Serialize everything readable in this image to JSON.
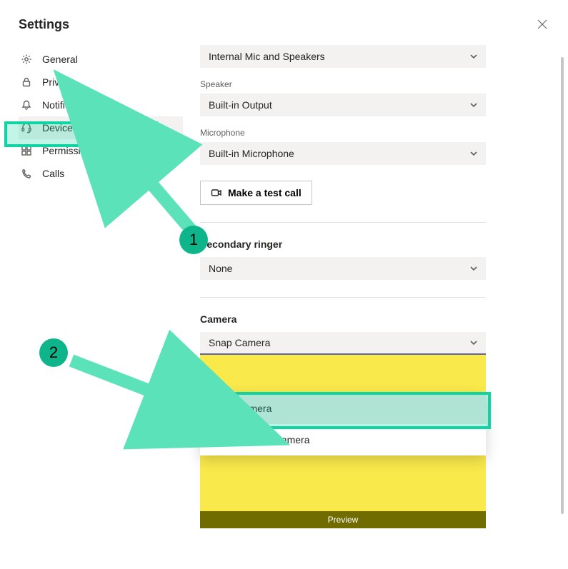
{
  "header": {
    "title": "Settings"
  },
  "sidebar": {
    "items": [
      {
        "label": "General"
      },
      {
        "label": "Privacy"
      },
      {
        "label": "Notifications"
      },
      {
        "label": "Devices"
      },
      {
        "label": "Permissions"
      },
      {
        "label": "Calls"
      }
    ]
  },
  "audio_device": {
    "current": "Internal Mic and Speakers"
  },
  "speaker": {
    "label": "Speaker",
    "current": "Built-in Output"
  },
  "microphone": {
    "label": "Microphone",
    "current": "Built-in Microphone"
  },
  "test_call": {
    "label": "Make a test call"
  },
  "secondary_ringer": {
    "label": "Secondary ringer",
    "current": "None"
  },
  "camera": {
    "label": "Camera",
    "current": "Snap Camera",
    "options": [
      "Snap Camera",
      "FaceTime HD Camera"
    ]
  },
  "preview": {
    "label": "Preview"
  },
  "annotations": {
    "badge1": "1",
    "badge2": "2"
  }
}
